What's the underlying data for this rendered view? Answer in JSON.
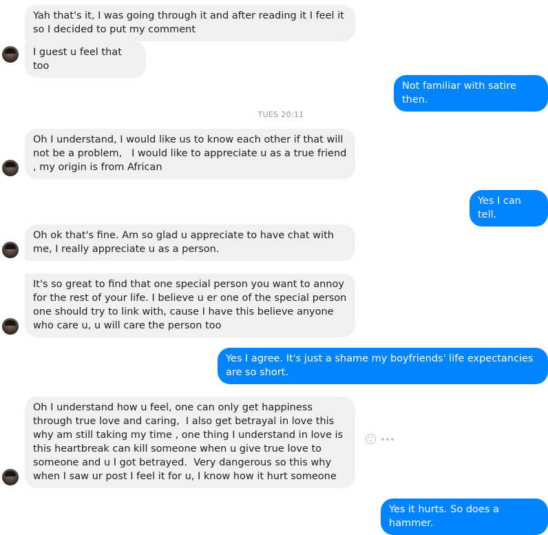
{
  "conversation": {
    "timestamp": "TUES 20:11",
    "messages": [
      {
        "id": "m1",
        "sender": "them",
        "text": "Yah that's it, I was going through it and after reading it I feel it so I decided to put my comment"
      },
      {
        "id": "m2",
        "sender": "them",
        "text": "I guest u feel that too"
      },
      {
        "id": "m3",
        "sender": "me",
        "text": "Not familiar with satire then."
      },
      {
        "id": "m4",
        "sender": "them",
        "text": "Oh I understand, I would like us to know each other if that will not be a problem,   I would like to appreciate u as a true friend , my origin is from African"
      },
      {
        "id": "m5",
        "sender": "me",
        "text": "Yes I can tell."
      },
      {
        "id": "m6",
        "sender": "them",
        "text": "Oh ok that's fine. Am so glad u appreciate to have chat with me, I really appreciate u as a person."
      },
      {
        "id": "m7",
        "sender": "them",
        "text": "It's so great to find that one special person you want to annoy for the rest of your life. I believe u er one of the special person one should try to link with, cause I have this believe anyone who care u, u will care the person too"
      },
      {
        "id": "m8",
        "sender": "me",
        "text": "Yes I agree. It's just a shame my boyfriends' life expectancies are so short."
      },
      {
        "id": "m9",
        "sender": "them",
        "text": "Oh I understand how u feel, one can only get happiness through true love and caring,  I also get betrayal in love this why am still taking my time , one thing I understand in love is this heartbreak can kill someone when u give true love to someone and u I got betrayed.  Very dangerous so this why when I saw ur post I feel it for u, I know how it hurt someone"
      },
      {
        "id": "m10",
        "sender": "me",
        "text": "Yes it hurts. So does a hammer."
      }
    ]
  },
  "icons": {
    "avatar": "contact-avatar",
    "react": "smiley-icon",
    "more": "more-dots-icon"
  },
  "colors": {
    "outgoing_bubble": "#0084ff",
    "incoming_bubble": "#f1f0f0",
    "timestamp": "#90949c"
  }
}
